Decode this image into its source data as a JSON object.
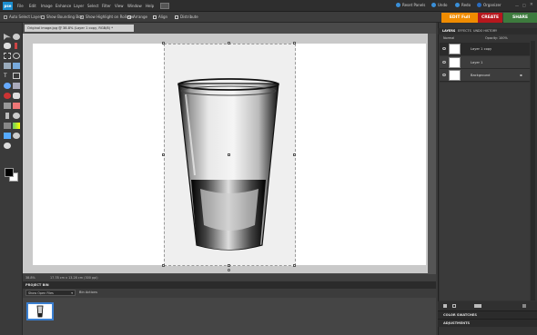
{
  "app": {
    "logo": "pse"
  },
  "menu": [
    "File",
    "Edit",
    "Image",
    "Enhance",
    "Layer",
    "Select",
    "Filter",
    "View",
    "Window",
    "Help"
  ],
  "topright": {
    "reset": "Reset Panels",
    "undo": "Undo",
    "redo": "Redo",
    "organizer": "Organizer"
  },
  "options": [
    "Auto Select Layer",
    "Show Bounding Box",
    "Show Highlight on Rollover",
    "Arrange",
    "Align",
    "Distribute"
  ],
  "modes": {
    "edit": "EDIT Full",
    "create": "CREATE",
    "share": "SHARE"
  },
  "document": {
    "tab": "Original image.jpg @ 38.8% (Layer 1 copy, RGB/8) *",
    "zoom": "38.8%",
    "info": "17.78 cm x 13.28 cm (300 ppi)"
  },
  "bin": {
    "title": "PROJECT BIN",
    "dropdown": "Show Open Files",
    "actions": "Bin Actions"
  },
  "panel": {
    "tabs": [
      "LAYERS",
      "EFFECTS",
      "UNDO HISTORY"
    ],
    "blend": "Normal",
    "opacity_label": "Opacity:",
    "opacity": "100%",
    "layers": [
      {
        "name": "Layer 1 copy",
        "selected": true
      },
      {
        "name": "Layer 1",
        "selected": false
      },
      {
        "name": "Background",
        "selected": false
      }
    ],
    "color_swatches": "COLOR SWATCHES",
    "adjustments": "ADJUSTMENTS"
  },
  "colors": {
    "accent": "#f08c00",
    "create": "#b7171d",
    "share": "#3d7a3d",
    "selection": "#3a7fd0"
  }
}
